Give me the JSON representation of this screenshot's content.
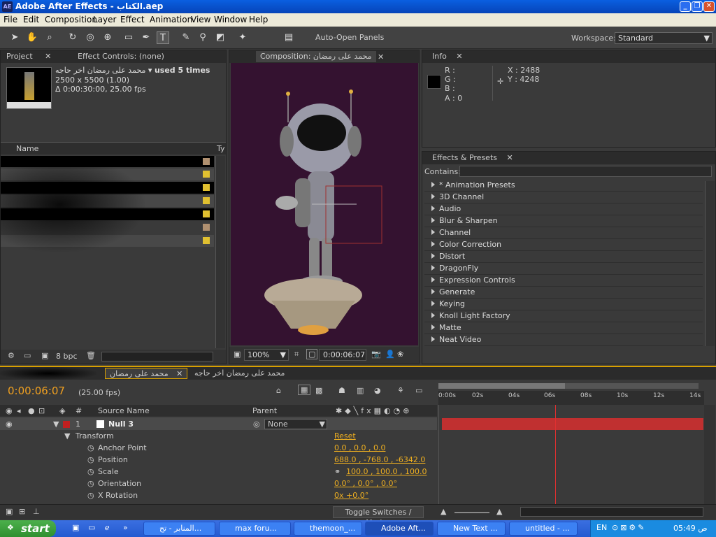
{
  "window": {
    "title": "Adobe After Effects - الكتاب.aep",
    "min": "_",
    "max": "❐",
    "close": "✕"
  },
  "menu": [
    "File",
    "Edit",
    "Composition",
    "Layer",
    "Effect",
    "Animation",
    "View",
    "Window",
    "Help"
  ],
  "toolbar": {
    "auto_open": "Auto-Open Panels",
    "workspace_label": "Workspace:",
    "workspace_value": "Standard"
  },
  "project": {
    "tab": "Project",
    "effect_tab": "Effect Controls: (none)",
    "item_name": "محمد على رمضان اخر حاجه",
    "used": "used 5 times",
    "dims": "2500 x 5500 (1.00)",
    "duration": "Δ 0:00:30:00, 25.00 fps",
    "col_name": "Name",
    "col_type": "Ty",
    "bpc": "8 bpc"
  },
  "comp": {
    "tab": "Composition: محمد على رمضان",
    "zoom": "100%",
    "time": "0:00:06:07"
  },
  "info": {
    "tab": "Info",
    "r": "R :",
    "g": "G :",
    "b": "B :",
    "a": "A : 0",
    "x": "X : 2488",
    "y": "Y : 4248"
  },
  "effects": {
    "tab": "Effects & Presets",
    "contains": "Contains:",
    "items": [
      "* Animation Presets",
      "3D Channel",
      "Audio",
      "Blur & Sharpen",
      "Channel",
      "Color Correction",
      "Distort",
      "DragonFly",
      "Expression Controls",
      "Generate",
      "Keying",
      "Knoll Light Factory",
      "Matte",
      "Neat Video"
    ]
  },
  "timeline": {
    "tab1": "محمد على رمضان",
    "tab2": "محمد على رمضان اخر حاجه",
    "time": "0:00:06:07",
    "fps": "(25.00 fps)",
    "col_num": "#",
    "col_source": "Source Name",
    "col_parent": "Parent",
    "layer_num": "1",
    "layer_name": "Null 3",
    "parent_value": "None",
    "transform": "Transform",
    "reset": "Reset",
    "props": [
      {
        "name": "Anchor Point",
        "value": "0.0 , 0.0 , 0.0"
      },
      {
        "name": "Position",
        "value": "688.0 , -768.0 , -6342.0"
      },
      {
        "name": "Scale",
        "value": "100.0 , 100.0 , 100.0"
      },
      {
        "name": "Orientation",
        "value": "0.0° , 0.0° , 0.0°"
      },
      {
        "name": "X Rotation",
        "value": "0x +0.0°"
      }
    ],
    "ticks": [
      "0:00s",
      "02s",
      "04s",
      "06s",
      "08s",
      "10s",
      "12s",
      "14s"
    ],
    "toggle": "Toggle Switches / Modes"
  },
  "taskbar": {
    "start": "start",
    "buttons": [
      "المنابر - تح...",
      "max foru...",
      "themoon_...",
      "Adobe Aft...",
      "New Text ...",
      "untitled - ..."
    ],
    "lang": "EN",
    "clock": "05:49 ص"
  }
}
